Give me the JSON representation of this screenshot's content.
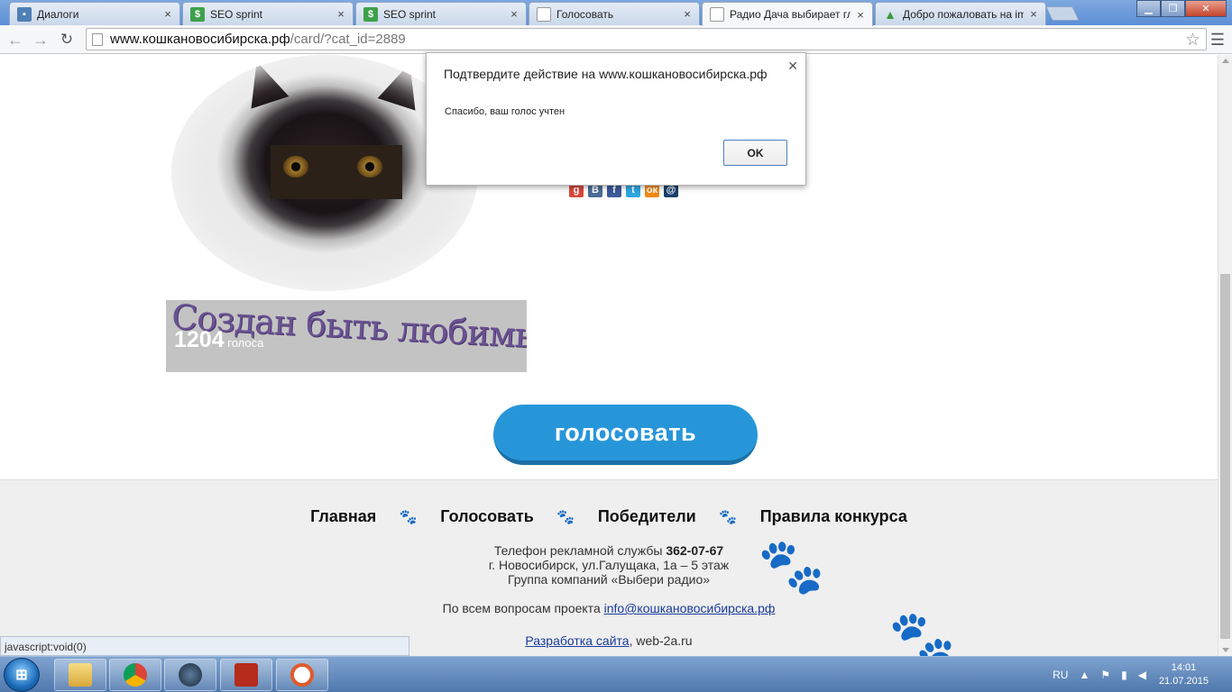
{
  "tabs": [
    {
      "title": "Диалоги",
      "icon": "dialog-icon"
    },
    {
      "title": "SEO sprint",
      "icon": "seo-sprint-icon"
    },
    {
      "title": "SEO sprint",
      "icon": "seo-sprint-icon"
    },
    {
      "title": "Голосовать",
      "icon": "page-icon"
    },
    {
      "title": "Радио Дача выбирает гл",
      "icon": "page-icon"
    },
    {
      "title": "Добро пожаловать на im",
      "icon": "upload-arrow-icon"
    }
  ],
  "address": {
    "host": "www.кошкановосибирска.рф",
    "path": "/card/?cat_id=2889"
  },
  "card": {
    "name": "Создан быть любимым",
    "votes_count": "1204",
    "votes_word": "голоса"
  },
  "share_icons": [
    {
      "name": "share-google-icon",
      "glyph": "g",
      "color": "#d9473b"
    },
    {
      "name": "share-vk-icon",
      "glyph": "В",
      "color": "#4a6c95"
    },
    {
      "name": "share-facebook-icon",
      "glyph": "f",
      "color": "#3b5998"
    },
    {
      "name": "share-twitter-icon",
      "glyph": "t",
      "color": "#2ea7df"
    },
    {
      "name": "share-odnoklassniki-icon",
      "glyph": "ок",
      "color": "#ef8a14"
    },
    {
      "name": "share-mailru-icon",
      "glyph": "@",
      "color": "#1a3f6b"
    }
  ],
  "vote_button": "голосовать",
  "footer": {
    "nav": [
      "Главная",
      "Голосовать",
      "Победители",
      "Правила конкурса"
    ],
    "phone_label": "Телефон рекламной службы",
    "phone": "362-07-67",
    "address": "г. Новосибирск, ул.Галущака, 1а – 5 этаж",
    "group": "Группа компаний «Выбери радио»",
    "questions_label": "По всем вопросам проекта",
    "email": "info@кошкановосибирска.рф",
    "dev_link": "Разработка сайта",
    "dev_suffix": ", web-2a.ru"
  },
  "status_bubble": "javascript:void(0)",
  "dialog": {
    "title": "Подтвердите действие на www.кошкановосибирска.рф",
    "message": "Спасибо, ваш голос учтен",
    "ok": "OK"
  },
  "taskbar": {
    "lang": "RU",
    "time": "14:01",
    "date": "21.07.2015"
  }
}
